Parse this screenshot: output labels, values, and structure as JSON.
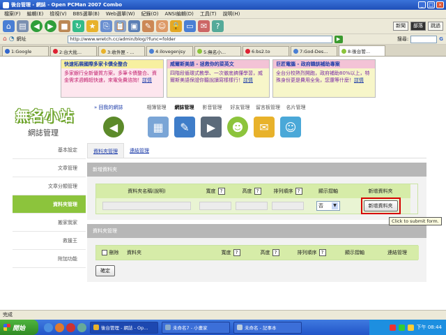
{
  "window": {
    "title": "後台管理 - 網誌 - Open PCMan 2007 Combo"
  },
  "menu": [
    "檔案(F)",
    "編輯(E)",
    "檢視(V)",
    "BBS選單(B)",
    "Web選單(W)",
    "紀錄(O)",
    "ANSI編輯(D)",
    "工具(T)",
    "說明(H)"
  ],
  "toolbar": {
    "btn_news": "新聞",
    "btn_blog": "部落",
    "btn_skip": "跳過"
  },
  "address": {
    "label": "網址",
    "url": "http://www.wretch.cc/admin/blog/?func=folder",
    "search_label": "搜尋:"
  },
  "tabs": [
    {
      "label": "1:Google"
    },
    {
      "label": "2:台大批..."
    },
    {
      "label": "3:收件匣 - ..."
    },
    {
      "label": "4:ilovegenjsy"
    },
    {
      "label": "5:無名小..."
    },
    {
      "label": "6:bs2.to"
    },
    {
      "label": "7:God-Des..."
    },
    {
      "label": "8:後台管..."
    }
  ],
  "ads": [
    {
      "head": "快速拓展國際多家卡債全整合",
      "body": "多家銀行全新優質方案，多筆卡債整合、資金需求週轉超快速，來電免費諮詢！",
      "link": "詳情"
    },
    {
      "head": "威爾斯美語 - 拯救你的菜英文",
      "body": "四階段循環式教學、一次徹底搞懂學習，威爾斯美語保證你聽說讀寫樣樣行！",
      "link": "詳情"
    },
    {
      "head": "巨匠電腦 - 政府職訓補助專案",
      "body": "全台分校熱烈開跑，政府補助80%以上，特殊身份更是費用全免，您還等什麼！",
      "link": "詳情"
    }
  ],
  "site": {
    "logo": "無名小站",
    "subtitle": "網誌管理"
  },
  "topnav": {
    "home": "» 回我的網誌",
    "items": [
      "相簿管理",
      "網誌管理",
      "影音管理",
      "好友管理",
      "留言板管理",
      "名片管理"
    ]
  },
  "sidebar": [
    "基本設定",
    "文章管理",
    "文章分類管理",
    "資料夾管理",
    "搬家我家",
    "救援王",
    "附加功能"
  ],
  "subtabs": [
    "資料夾管理",
    "連結管理"
  ],
  "newfolder": {
    "title": "新增資料夾",
    "headers": [
      "資料夾名稱(說明)",
      "寬度",
      "高度",
      "排列順序",
      "顯示摺軸",
      "新增資料夾"
    ],
    "help": "?",
    "select_value": "否",
    "add_button": "新增資料夾"
  },
  "tooltip": "Click to submit form.",
  "folders": {
    "title": "資料夾管理",
    "headers": [
      "刪除",
      "資料夾",
      "寬度",
      "高度",
      "排列順序",
      "顯示摺軸",
      "連結管理"
    ],
    "confirm_button": "確定"
  },
  "status": "完成",
  "taskbar": {
    "start": "開始",
    "tasks": [
      "後台管理 - 網誌 - Op...",
      "未命名7 - 小畫家",
      "未命名 - 記事本"
    ],
    "clock": "下午 08:44"
  }
}
